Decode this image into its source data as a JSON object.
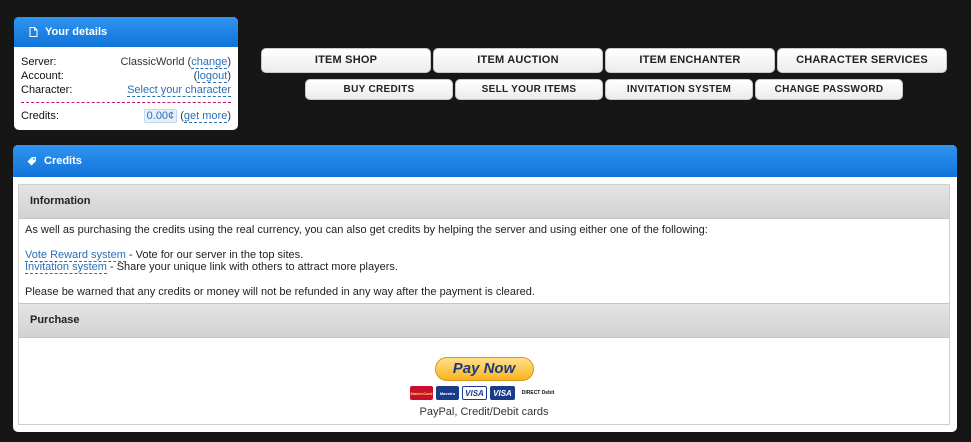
{
  "details": {
    "title": "Your details",
    "server_label": "Server:",
    "server_value": "ClassicWorld",
    "change_link": "change",
    "account_label": "Account:",
    "logout_link": "logout",
    "character_label": "Character:",
    "select_character_link": "Select your character",
    "credits_label": "Credits:",
    "credits_value": "0.00¢",
    "get_more_link": "get more"
  },
  "nav": {
    "row1": [
      "ITEM SHOP",
      "ITEM AUCTION",
      "ITEM ENCHANTER",
      "CHARACTER SERVICES"
    ],
    "row2": [
      "BUY CREDITS",
      "SELL YOUR ITEMS",
      "INVITATION SYSTEM",
      "CHANGE PASSWORD"
    ]
  },
  "credits_panel": {
    "title": "Credits",
    "information_heading": "Information",
    "intro_text": "As well as purchasing the credits using the real currency, you can also get credits by helping the server and using either one of the following:",
    "vote_link": "Vote Reward system",
    "vote_desc": " - Vote for our server in the top sites.",
    "invite_link": "Invitation system",
    "invite_desc": " - Share your unique link with others to attract more players.",
    "warning_text": "Please be warned that any credits or money will not be refunded in any way after the payment is cleared.",
    "purchase_heading": "Purchase",
    "pay_button": "Pay Now",
    "cards": [
      "MasterCard",
      "Maestro",
      "VISA",
      "VISA",
      "DIRECT Debit"
    ],
    "payment_caption": "PayPal, Credit/Debit cards"
  },
  "colors": {
    "header_blue": "#1a7fe3",
    "page_bg": "#161616",
    "link": "#2a6fb8",
    "paynow": "#f9b421"
  }
}
